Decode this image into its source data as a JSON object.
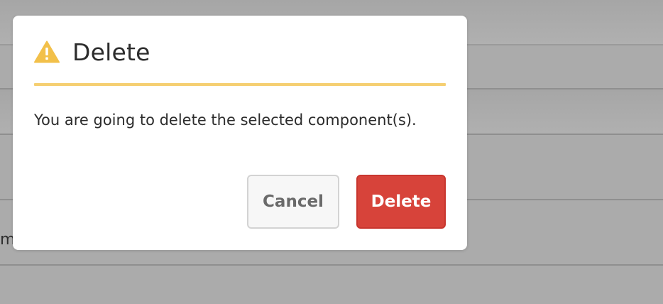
{
  "background": {
    "fragment_text": "m/"
  },
  "dialog": {
    "icon": "warning-triangle-icon",
    "icon_color": "#f2c04a",
    "title": "Delete",
    "accent_color": "#f5cf72",
    "message": "You are going to delete the selected component(s).",
    "cancel_label": "Cancel",
    "delete_label": "Delete",
    "delete_color": "#d7433a"
  }
}
